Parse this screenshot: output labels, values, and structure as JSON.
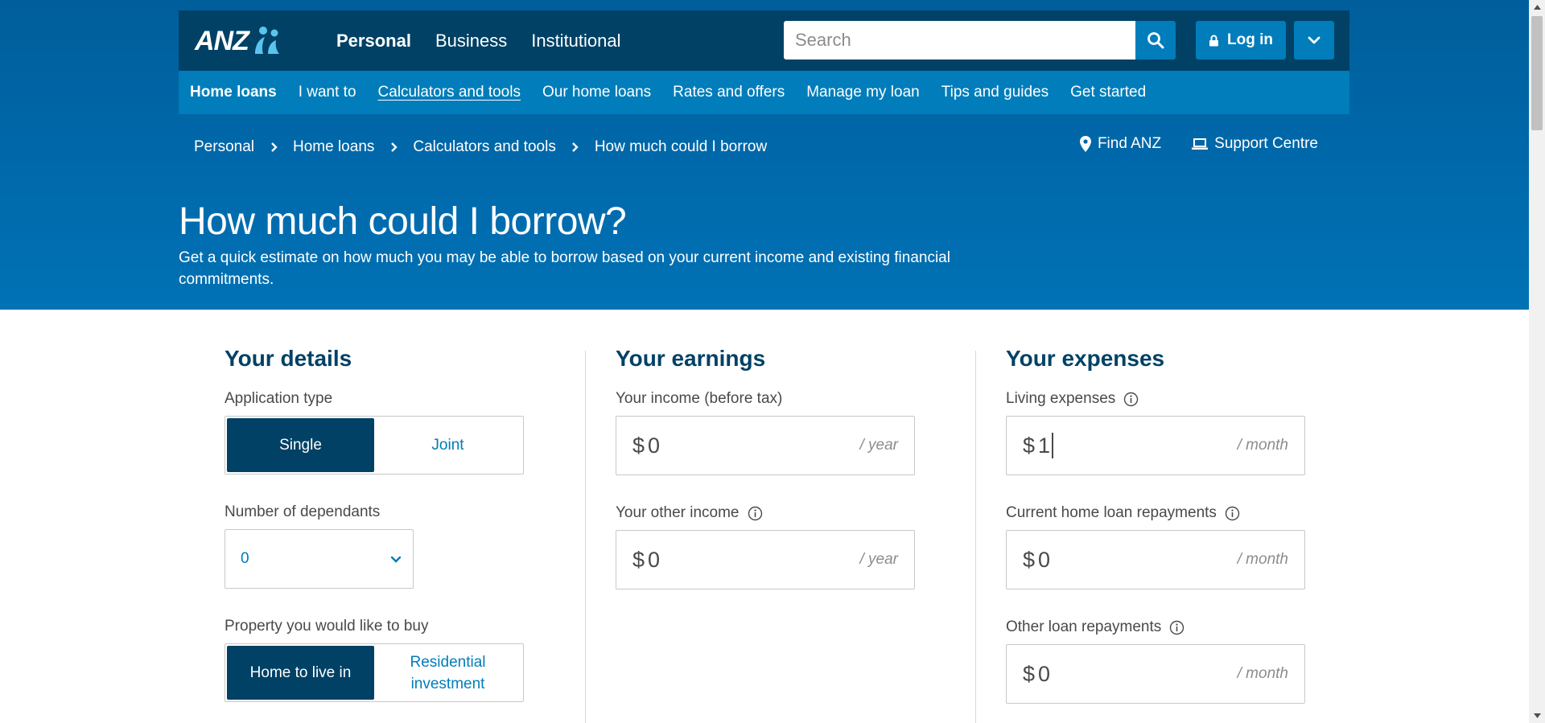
{
  "header": {
    "logo_text": "ANZ",
    "segments": [
      "Personal",
      "Business",
      "Institutional"
    ],
    "active_segment": "Personal",
    "search_placeholder": "Search",
    "login_label": "Log in"
  },
  "subnav": {
    "section": "Home loans",
    "items": [
      "I want to",
      "Calculators and tools",
      "Our home loans",
      "Rates and offers",
      "Manage my loan",
      "Tips and guides",
      "Get started"
    ],
    "current": "Calculators and tools"
  },
  "breadcrumb": [
    "Personal",
    "Home loans",
    "Calculators and tools",
    "How much could I borrow"
  ],
  "utility": {
    "find": "Find ANZ",
    "support": "Support Centre"
  },
  "page": {
    "title": "How much could I borrow?",
    "intro": "Get a quick estimate on how much you may be able to borrow based on your current income and existing financial commitments."
  },
  "details": {
    "heading": "Your details",
    "application_type": {
      "label": "Application type",
      "options": [
        "Single",
        "Joint"
      ],
      "selected": "Single"
    },
    "dependants": {
      "label": "Number of dependants",
      "value": "0"
    },
    "property": {
      "label": "Property you would like to buy",
      "options": [
        "Home to live in",
        "Residential investment"
      ],
      "selected": "Home to live in"
    }
  },
  "earnings": {
    "heading": "Your earnings",
    "income": {
      "label": "Your income (before tax)",
      "currency": "$",
      "value": "0",
      "unit": "/ year"
    },
    "other_income": {
      "label": "Your other income",
      "currency": "$",
      "value": "0",
      "unit": "/ year"
    }
  },
  "expenses": {
    "heading": "Your expenses",
    "living": {
      "label": "Living expenses",
      "currency": "$",
      "value": "1",
      "unit": "/ month"
    },
    "home_loan": {
      "label": "Current home loan repayments",
      "currency": "$",
      "value": "0",
      "unit": "/ month"
    },
    "other_loan": {
      "label": "Other loan repayments",
      "currency": "$",
      "value": "0",
      "unit": "/ month"
    }
  },
  "colors": {
    "navy": "#004165",
    "blue": "#007dba",
    "hero": "#0069ab"
  }
}
